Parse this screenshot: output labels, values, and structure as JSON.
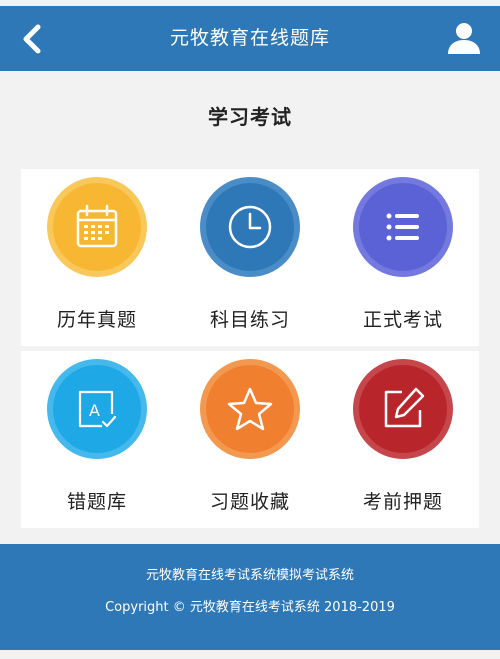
{
  "header": {
    "title": "元牧教育在线题库",
    "back_icon": "back-arrow-icon",
    "user_icon": "user-icon",
    "color": "#2f78b7"
  },
  "section": {
    "title": "学习考试"
  },
  "tiles": [
    {
      "label": "历年真题",
      "icon": "calendar-icon",
      "color": "#f7b733"
    },
    {
      "label": "科目练习",
      "icon": "clock-icon",
      "color": "#2f78b7"
    },
    {
      "label": "正式考试",
      "icon": "list-icon",
      "color": "#5b62d6"
    },
    {
      "label": "错题库",
      "icon": "answer-sheet-icon",
      "color": "#1fa8e6"
    },
    {
      "label": "习题收藏",
      "icon": "star-icon",
      "color": "#f07f2f"
    },
    {
      "label": "考前押题",
      "icon": "edit-icon",
      "color": "#b8252b"
    }
  ],
  "footer": {
    "line1": "元牧教育在线考试系统模拟考试系统",
    "line2": "Copyright © 元牧教育在线考试系统 2018-2019"
  }
}
